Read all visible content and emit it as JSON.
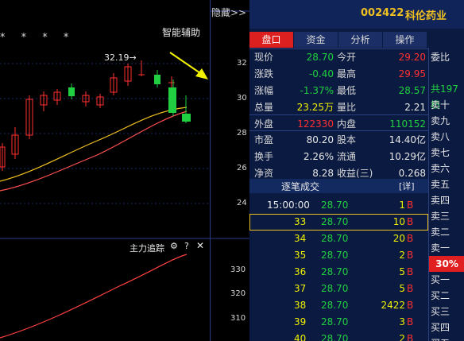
{
  "chart": {
    "hide_label": "隐藏>>",
    "assist_label": "智能辅助",
    "stars": "* * * *",
    "high_mark": "32.19→",
    "price_ticks": [
      "32",
      "30",
      "28",
      "26",
      "24"
    ],
    "indicator_title": "主力追踪",
    "indicator_ticks": [
      "330",
      "320",
      "310"
    ]
  },
  "quote": {
    "code": "002422",
    "name": "科伦药业",
    "tabs": [
      "盘口",
      "资金",
      "分析",
      "操作"
    ],
    "stats": [
      {
        "l1": "现价",
        "v1": "28.70",
        "c1": "green",
        "l2": "今开",
        "v2": "29.20",
        "c2": "red"
      },
      {
        "l1": "涨跌",
        "v1": "-0.40",
        "c1": "green",
        "l2": "最高",
        "v2": "29.95",
        "c2": "red"
      },
      {
        "l1": "涨幅",
        "v1": "-1.37%",
        "c1": "green",
        "l2": "最低",
        "v2": "28.57",
        "c2": "green"
      },
      {
        "l1": "总量",
        "v1": "23.25万",
        "c1": "yellow",
        "l2": "量比",
        "v2": "2.21",
        "c2": "white"
      },
      {
        "l1": "外盘",
        "v1": "122330",
        "c1": "red",
        "l2": "内盘",
        "v2": "110152",
        "c2": "green"
      },
      {
        "l1": "市盈",
        "v1": "80.20",
        "c1": "white",
        "l2": "股本",
        "v2": "14.40亿",
        "c2": "white"
      },
      {
        "l1": "换手",
        "v1": "2.26%",
        "c1": "white",
        "l2": "流通",
        "v2": "10.29亿",
        "c2": "white"
      },
      {
        "l1": "净资",
        "v1": "8.28",
        "c1": "white",
        "l2": "收益(三)",
        "v2": "0.268",
        "c2": "white"
      }
    ],
    "ticks_title": "逐笔成交",
    "ticks_detail": "[详]",
    "ticks": [
      {
        "time": "15:00:00",
        "price": "28.70",
        "vol": "1",
        "bs": "B"
      },
      {
        "time": "33",
        "price": "28.70",
        "vol": "10",
        "bs": "B"
      },
      {
        "time": "34",
        "price": "28.70",
        "vol": "20",
        "bs": "B"
      },
      {
        "time": "35",
        "price": "28.70",
        "vol": "2",
        "bs": "B"
      },
      {
        "time": "36",
        "price": "28.70",
        "vol": "5",
        "bs": "B"
      },
      {
        "time": "37",
        "price": "28.70",
        "vol": "5",
        "bs": "B"
      },
      {
        "time": "38",
        "price": "28.70",
        "vol": "2422",
        "bs": "B"
      },
      {
        "time": "39",
        "price": "28.70",
        "vol": "3",
        "bs": "B"
      },
      {
        "time": "40",
        "price": "28.70",
        "vol": "2",
        "bs": "B"
      }
    ],
    "side": {
      "weibi": "委比",
      "total": "共197档",
      "sells": [
        "卖十",
        "卖九",
        "卖八",
        "卖七",
        "卖六",
        "卖五",
        "卖四",
        "卖三",
        "卖二",
        "卖一"
      ],
      "pct": "30%",
      "buys": [
        "买一",
        "买二",
        "买三",
        "买四",
        "买五"
      ]
    }
  },
  "colors": {
    "up": "#ff3030",
    "down": "#20d040",
    "accent": "#f0c020",
    "tab_active": "#dc2020"
  }
}
